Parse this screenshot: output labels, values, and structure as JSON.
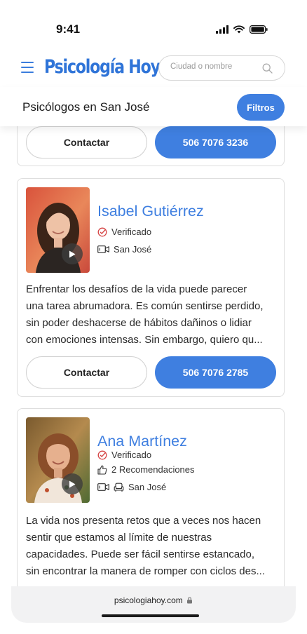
{
  "status_bar": {
    "time": "9:41"
  },
  "header": {
    "logo": "Psicología Hoy",
    "search_placeholder": "Ciudad o nombre"
  },
  "subheader": {
    "title": "Psicólogos en San José",
    "filters_label": "Filtros"
  },
  "partial_card": {
    "contact_label": "Contactar",
    "phone_label": "506 7076 3236"
  },
  "cards": [
    {
      "name": "Isabel Gutiérrez",
      "verified_label": "Verificado",
      "location": "San José",
      "bio_lines": [
        "Enfrentar los desafíos de la vida puede parecer",
        "una tarea abrumadora. Es común sentirse perdido,",
        "sin poder deshacerse de hábitos dañinos o lidiar",
        "con emociones intensas. Sin embargo, quiero qu..."
      ],
      "contact_label": "Contactar",
      "phone_label": "506 7076 2785"
    },
    {
      "name": "Ana Martínez",
      "verified_label": "Verificado",
      "recommendations": "2 Recomendaciones",
      "location": "San José",
      "bio_lines": [
        "La vida nos presenta retos que a veces nos hacen",
        "sentir que estamos al límite de nuestras",
        "capacidades. Puede ser fácil sentirse estancado,",
        "sin encontrar la manera de romper con ciclos des..."
      ]
    }
  ],
  "browser": {
    "url": "psicologiahoy.com"
  },
  "colors": {
    "accent": "#3f7fe0",
    "border": "#dedede"
  },
  "icons": [
    "menu-icon",
    "search-icon",
    "verified-icon",
    "video-icon",
    "thumbs-up-icon",
    "sofa-icon",
    "play-icon",
    "lock-icon",
    "signal-icon",
    "wifi-icon",
    "battery-icon"
  ]
}
